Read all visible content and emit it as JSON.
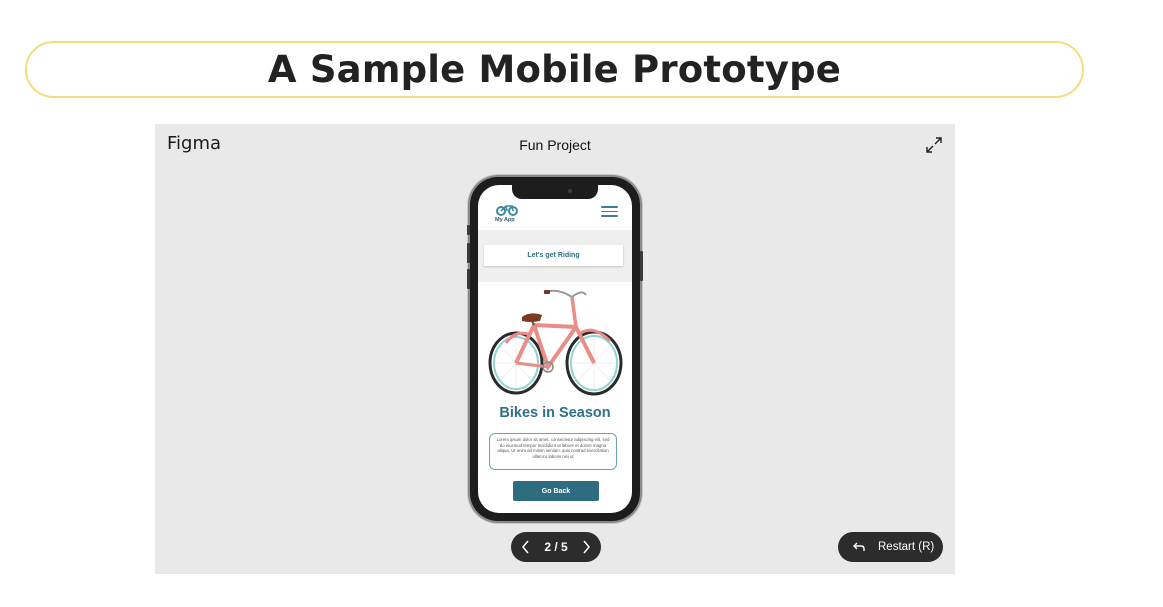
{
  "page": {
    "title": "A Sample Mobile Prototype"
  },
  "embed": {
    "brand": "Figma",
    "project_title": "Fun Project",
    "expand_icon": "expand-icon"
  },
  "app": {
    "logo_label": "My App",
    "banner_text": "Let's get Riding",
    "heading": "Bikes in Season",
    "description": "Lorem ipsum dolor sit amet, consectetur adipiscing elit, sed do eiusmod tempor incididunt ut labore et dolore magna aliqua. Ut enim ad minim veniam, quis nostrud exercitation ullamco laboris nisi ut",
    "button_label": "Go Back"
  },
  "navigation": {
    "page_indicator": "2 / 5",
    "restart_label": "Restart (R)"
  },
  "colors": {
    "title_border": "#f3db7f",
    "embed_bg": "#e9e9e9",
    "app_accent": "#2e6d80",
    "control_bg": "#2c2c2c"
  }
}
